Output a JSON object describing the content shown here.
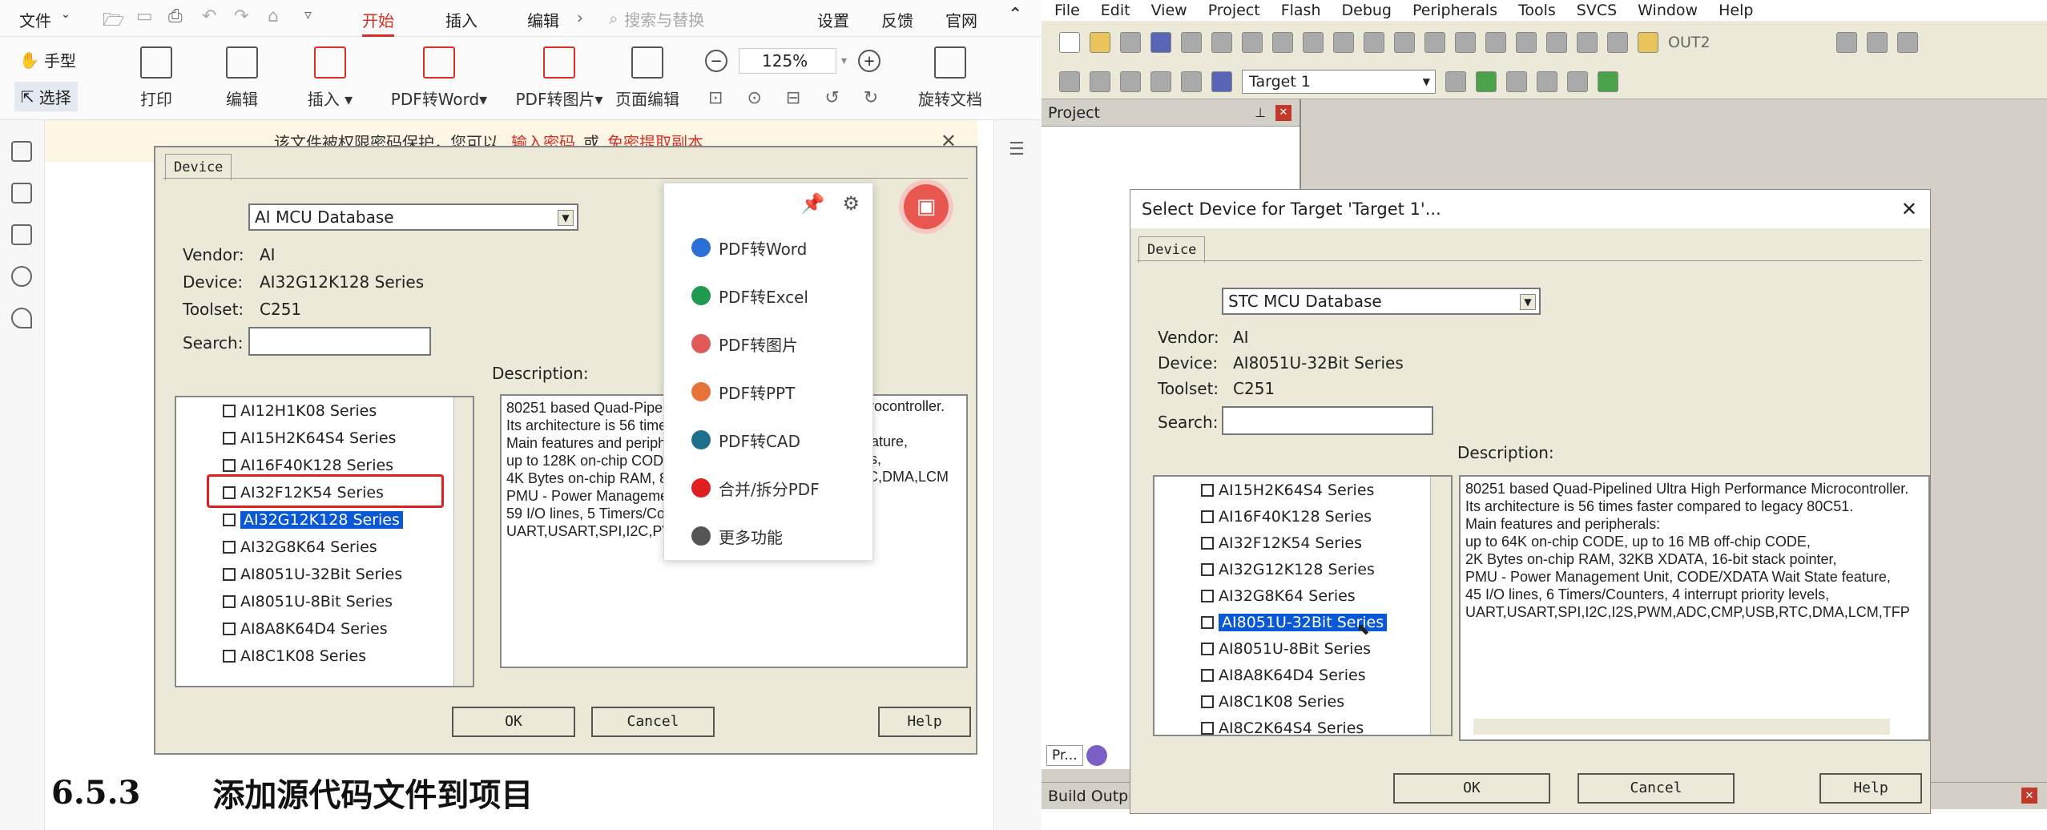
{
  "pdf": {
    "top": {
      "file": "文件",
      "start": "开始",
      "insert": "插入",
      "edit": "编辑",
      "search_ph": "搜索与替换",
      "settings": "设置",
      "feedback": "反馈",
      "website": "官网"
    },
    "hand": "手型",
    "select": "选择",
    "ribbon": [
      "打印",
      "编辑",
      "插入",
      "PDF转Word",
      "PDF转图片",
      "页面编辑",
      "旋转文档"
    ],
    "zoom": "125%",
    "notice": {
      "text": "该文件被权限密码保护，您可以",
      "link1": "输入密码",
      "or": "或",
      "link2": "免密提取副本"
    },
    "dialog": {
      "tab": "Device",
      "db": "AI MCU Database",
      "vendor_l": "Vendor:",
      "vendor": "AI",
      "device_l": "Device:",
      "device": "AI32G12K128 Series",
      "toolset_l": "Toolset:",
      "toolset": "C251",
      "search_l": "Search:",
      "desc_l": "Description:",
      "items": [
        "AI12H1K08 Series",
        "AI15H2K64S4 Series",
        "AI16F40K128 Series",
        "AI32F12K54 Series",
        "AI32G12K128 Series",
        "AI32G8K64 Series",
        "AI8051U-32Bit Series",
        "AI8051U-8Bit Series",
        "AI8A8K64D4 Series",
        "AI8C1K08 Series"
      ],
      "desc": [
        "80251 based Quad-Pipelin",
        "Its architecture is 56 times",
        "Main features and periphe",
        "up to 128K on-chip CODE",
        "4K Bytes on-chip RAM, 8",
        "PMU - Power Managemen",
        "59 I/O lines, 5 Timers/Cou",
        "UART,USART,SPI,I2C,PV"
      ],
      "desc_right": [
        "icrocontroller.",
        "1.",
        "",
        "",
        "",
        "feature,",
        "els,",
        "TC,DMA,LCM"
      ],
      "ok": "OK",
      "cancel": "Cancel",
      "help": "Help"
    },
    "popup": [
      "PDF转Word",
      "PDF转Excel",
      "PDF转图片",
      "PDF转PPT",
      "PDF转CAD",
      "合并/拆分PDF",
      "更多功能"
    ],
    "heading_num": "6.5.3",
    "heading": "添加源代码文件到项目"
  },
  "keil": {
    "menu": [
      "File",
      "Edit",
      "View",
      "Project",
      "Flash",
      "Debug",
      "Peripherals",
      "Tools",
      "SVCS",
      "Window",
      "Help"
    ],
    "out": "OUT2",
    "target": "Target 1",
    "project": "Project",
    "proj_tab": "Pr...",
    "build": "Build Outpu",
    "dialog": {
      "title": "Select Device for Target 'Target 1'...",
      "tab": "Device",
      "db": "STC MCU Database",
      "vendor_l": "Vendor:",
      "vendor": "AI",
      "device_l": "Device:",
      "device": "AI8051U-32Bit Series",
      "toolset_l": "Toolset:",
      "toolset": "C251",
      "search_l": "Search:",
      "desc_l": "Description:",
      "items": [
        "AI15H2K64S4 Series",
        "AI16F40K128 Series",
        "AI32F12K54 Series",
        "AI32G12K128 Series",
        "AI32G8K64 Series",
        "AI8051U-32Bit Series",
        "AI8051U-8Bit Series",
        "AI8A8K64D4 Series",
        "AI8C1K08 Series",
        "AI8C2K64S4 Series"
      ],
      "desc": [
        "80251 based Quad-Pipelined Ultra High Performance Microcontroller.",
        "Its architecture is 56 times faster compared to legacy 80C51.",
        "Main features and peripherals:",
        "up to 64K on-chip CODE, up to 16 MB off-chip CODE,",
        "2K Bytes on-chip RAM, 32KB XDATA, 16-bit stack pointer,",
        "PMU - Power Management Unit, CODE/XDATA Wait State feature,",
        "45 I/O lines, 6 Timers/Counters, 4 interrupt priority levels,",
        "UART,USART,SPI,I2C,I2S,PWM,ADC,CMP,USB,RTC,DMA,LCM,TFP"
      ],
      "ok": "OK",
      "cancel": "Cancel",
      "help": "Help"
    }
  }
}
